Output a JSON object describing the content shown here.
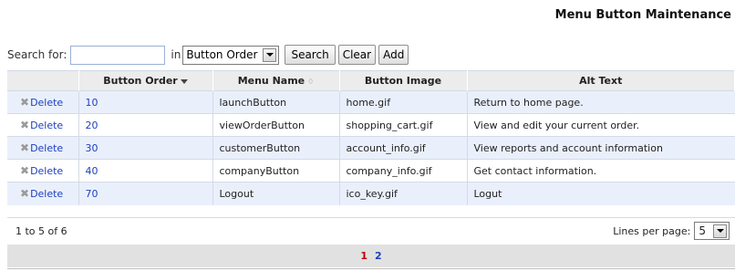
{
  "page": {
    "title": "Menu Button Maintenance"
  },
  "search": {
    "label": "Search for:",
    "value": "",
    "in_label": "in",
    "field_selected": "Button Order",
    "search_label": "Search",
    "clear_label": "Clear",
    "add_label": "Add"
  },
  "table": {
    "columns": [
      "",
      "Button Order",
      "Menu Name",
      "Button Image",
      "Alt Text"
    ],
    "sort_column": "Button Order",
    "sort_direction": "descending-indicator",
    "delete_label": "Delete",
    "rows": [
      {
        "order": "10",
        "name": "launchButton",
        "image": "home.gif",
        "alt": "Return to home page."
      },
      {
        "order": "20",
        "name": "viewOrderButton",
        "image": "shopping_cart.gif",
        "alt": "View and edit your current order."
      },
      {
        "order": "30",
        "name": "customerButton",
        "image": "account_info.gif",
        "alt": "View reports and account information"
      },
      {
        "order": "40",
        "name": "companyButton",
        "image": "company_info.gif",
        "alt": "Get contact information."
      },
      {
        "order": "70",
        "name": "Logout",
        "image": "ico_key.gif",
        "alt": "Logut"
      }
    ]
  },
  "footer": {
    "range": "1 to 5 of 6",
    "lines_label": "Lines per page:",
    "lines_value": "5"
  },
  "pager": {
    "current": "1",
    "pages": [
      "2"
    ]
  },
  "colors": {
    "link": "#1d3fbf",
    "current_page": "#c00000",
    "row_alt": "#eaf0fb",
    "header_bg": "#ececec"
  }
}
